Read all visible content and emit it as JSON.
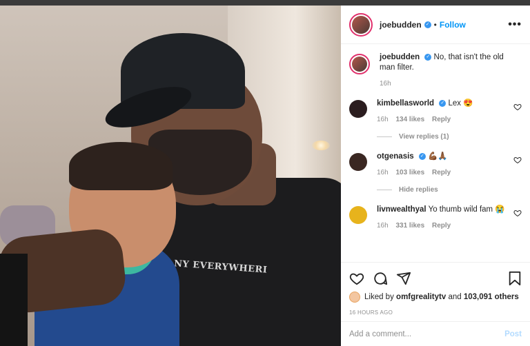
{
  "post": {
    "author": "joebudden",
    "follow_label": "Follow",
    "dot": "•",
    "more": "•••",
    "caption": "No, that isn't the old man filter.",
    "caption_time": "16h",
    "photo_shirt_text": "NY EVERYWHERI"
  },
  "comments": [
    {
      "user": "kimbellasworld",
      "text": "Lex 😍",
      "time": "16h",
      "likes": "134 likes",
      "reply": "Reply",
      "replies_label": "View replies (1)"
    },
    {
      "user": "otgenasis",
      "text": "💪🏾🙏🏾",
      "time": "16h",
      "likes": "103 likes",
      "reply": "Reply",
      "replies_label": "Hide replies"
    },
    {
      "user": "livnwealthyal",
      "text": "Yo thumb wild fam 😭",
      "time": "16h",
      "likes": "331 likes",
      "reply": "Reply"
    }
  ],
  "likes_summary": {
    "prefix": "Liked by",
    "user": "omfgrealitytv",
    "and": "and",
    "others": "103,091 others"
  },
  "timestamp": "16 HOURS AGO",
  "add_comment": {
    "placeholder": "Add a comment...",
    "post_label": "Post"
  },
  "colors": {
    "accent": "#0095f6",
    "verified": "#3897f0",
    "story_ring": "#e1306c",
    "post_disabled": "#b3dbff"
  },
  "icons": [
    "verified-icon",
    "more-icon",
    "heart-icon",
    "comment-icon",
    "share-icon",
    "bookmark-icon"
  ]
}
